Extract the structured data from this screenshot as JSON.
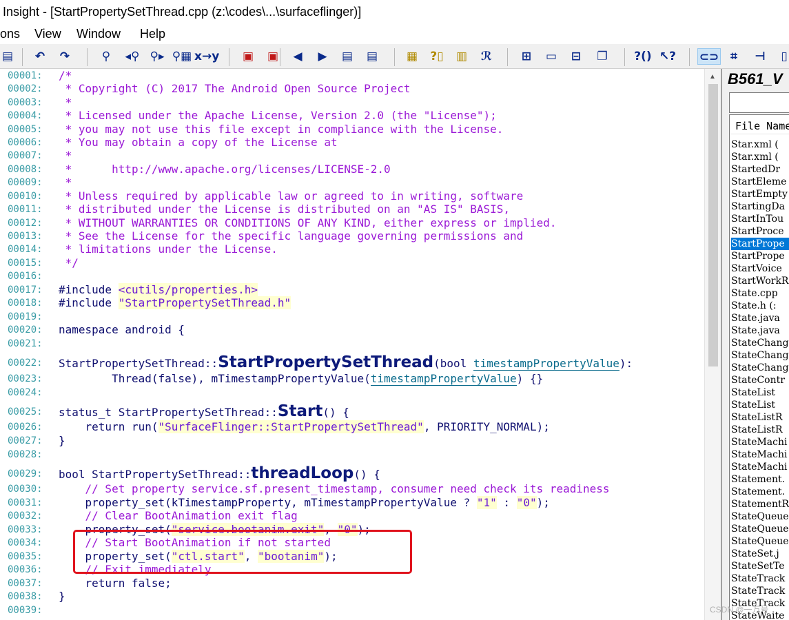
{
  "window": {
    "title": "Insight - [StartPropertySetThread.cpp (z:\\codes\\...\\surfaceflinger)]"
  },
  "menu": [
    "ons",
    "View",
    "Window",
    "Help"
  ],
  "toolbar_icons": [
    {
      "name": "paste-icon",
      "glyph": "▤"
    },
    {
      "name": "undo-icon",
      "glyph": "↶"
    },
    {
      "name": "redo-icon",
      "glyph": "↷"
    },
    {
      "name": "find-icon",
      "glyph": "⚲"
    },
    {
      "name": "find-prev-icon",
      "glyph": "◂⚲"
    },
    {
      "name": "find-next-icon",
      "glyph": "⚲▸"
    },
    {
      "name": "find-files-icon",
      "glyph": "⚲▦"
    },
    {
      "name": "replace-icon",
      "glyph": "x→y"
    },
    {
      "name": "bookmark-prev-icon",
      "glyph": "▣"
    },
    {
      "name": "bookmark-next-icon",
      "glyph": "▣"
    },
    {
      "name": "back-icon",
      "glyph": "◀"
    },
    {
      "name": "forward-icon",
      "glyph": "▶"
    },
    {
      "name": "jump-prev-icon",
      "glyph": "▤"
    },
    {
      "name": "jump-next-icon",
      "glyph": "▤"
    },
    {
      "name": "lookup-icon",
      "glyph": "▦"
    },
    {
      "name": "symbol-info-icon",
      "glyph": "?▯"
    },
    {
      "name": "browse-icon",
      "glyph": "▥"
    },
    {
      "name": "relation-icon",
      "glyph": "ℛ"
    },
    {
      "name": "layout-grid-icon",
      "glyph": "⊞"
    },
    {
      "name": "layout-panel-icon",
      "glyph": "▭"
    },
    {
      "name": "layout-split-icon",
      "glyph": "⊟"
    },
    {
      "name": "layout-windows-icon",
      "glyph": "❐"
    },
    {
      "name": "help-icon",
      "glyph": "?()"
    },
    {
      "name": "context-help-icon",
      "glyph": "↖?"
    },
    {
      "name": "link-icon",
      "glyph": "⊂⊃"
    },
    {
      "name": "context-window-icon",
      "glyph": "⌗"
    },
    {
      "name": "relation-window-icon",
      "glyph": "⊣"
    },
    {
      "name": "more-icon",
      "glyph": "▯"
    }
  ],
  "editor": {
    "lines": [
      {
        "n": "00001:",
        "parts": [
          {
            "t": "/*",
            "c": "cm"
          }
        ]
      },
      {
        "n": "00002:",
        "parts": [
          {
            "t": " * Copyright (C) 2017 The Android Open Source Project",
            "c": "cm"
          }
        ]
      },
      {
        "n": "00003:",
        "parts": [
          {
            "t": " *",
            "c": "cm"
          }
        ]
      },
      {
        "n": "00004:",
        "parts": [
          {
            "t": " * Licensed under the Apache License, Version 2.0 (the \"License\");",
            "c": "cm"
          }
        ]
      },
      {
        "n": "00005:",
        "parts": [
          {
            "t": " * you may not use this file except in compliance with the License.",
            "c": "cm"
          }
        ]
      },
      {
        "n": "00006:",
        "parts": [
          {
            "t": " * You may obtain a copy of the License at",
            "c": "cm"
          }
        ]
      },
      {
        "n": "00007:",
        "parts": [
          {
            "t": " *",
            "c": "cm"
          }
        ]
      },
      {
        "n": "00008:",
        "parts": [
          {
            "t": " *      http://www.apache.org/licenses/LICENSE-2.0",
            "c": "cm"
          }
        ]
      },
      {
        "n": "00009:",
        "parts": [
          {
            "t": " *",
            "c": "cm"
          }
        ]
      },
      {
        "n": "00010:",
        "parts": [
          {
            "t": " * Unless required by applicable law or agreed to in writing, software",
            "c": "cm"
          }
        ]
      },
      {
        "n": "00011:",
        "parts": [
          {
            "t": " * distributed under the License is distributed on an \"AS IS\" BASIS,",
            "c": "cm"
          }
        ]
      },
      {
        "n": "00012:",
        "parts": [
          {
            "t": " * WITHOUT WARRANTIES OR CONDITIONS OF ANY KIND, either express or implied.",
            "c": "cm"
          }
        ]
      },
      {
        "n": "00013:",
        "parts": [
          {
            "t": " * See the License for the specific language governing permissions and",
            "c": "cm"
          }
        ]
      },
      {
        "n": "00014:",
        "parts": [
          {
            "t": " * limitations under the License.",
            "c": "cm"
          }
        ]
      },
      {
        "n": "00015:",
        "parts": [
          {
            "t": " */",
            "c": "cm"
          }
        ]
      },
      {
        "n": "00016:",
        "parts": []
      },
      {
        "n": "00017:",
        "parts": [
          {
            "t": "#include ",
            "c": "kw"
          },
          {
            "t": "<cutils/properties.h>",
            "c": "str"
          }
        ]
      },
      {
        "n": "00018:",
        "parts": [
          {
            "t": "#include ",
            "c": "kw"
          },
          {
            "t": "\"StartPropertySetThread.h\"",
            "c": "str"
          }
        ]
      },
      {
        "n": "00019:",
        "parts": []
      },
      {
        "n": "00020:",
        "parts": [
          {
            "t": "namespace android {",
            "c": "kw"
          }
        ]
      },
      {
        "n": "00021:",
        "parts": []
      },
      {
        "n": "00022:",
        "big": true,
        "parts": [
          {
            "t": "StartPropertySetThread::",
            "c": "kw"
          },
          {
            "t": "StartPropertySetThread",
            "c": "fn"
          },
          {
            "t": "(bool ",
            "c": "kw"
          },
          {
            "t": "timestampPropertyValue",
            "c": "pl"
          },
          {
            "t": "):",
            "c": "kw"
          }
        ]
      },
      {
        "n": "00023:",
        "parts": [
          {
            "t": "        Thread(false), mTimestampPropertyValue(",
            "c": "kw"
          },
          {
            "t": "timestampPropertyValue",
            "c": "pl"
          },
          {
            "t": ") {}",
            "c": "kw"
          }
        ]
      },
      {
        "n": "00024:",
        "parts": []
      },
      {
        "n": "00025:",
        "big": true,
        "parts": [
          {
            "t": "status_t StartPropertySetThread::",
            "c": "kw"
          },
          {
            "t": "Start",
            "c": "fn"
          },
          {
            "t": "() {",
            "c": "kw"
          }
        ]
      },
      {
        "n": "00026:",
        "parts": [
          {
            "t": "    return run(",
            "c": "kw"
          },
          {
            "t": "\"SurfaceFlinger::StartPropertySetThread\"",
            "c": "str"
          },
          {
            "t": ", PRIORITY_NORMAL);",
            "c": "kw"
          }
        ]
      },
      {
        "n": "00027:",
        "parts": [
          {
            "t": "}",
            "c": "kw"
          }
        ]
      },
      {
        "n": "00028:",
        "parts": []
      },
      {
        "n": "00029:",
        "big": true,
        "parts": [
          {
            "t": "bool StartPropertySetThread::",
            "c": "kw"
          },
          {
            "t": "threadLoop",
            "c": "fn"
          },
          {
            "t": "() {",
            "c": "kw"
          }
        ]
      },
      {
        "n": "00030:",
        "parts": [
          {
            "t": "    // Set property service.sf.present_timestamp, consumer need check its readiness",
            "c": "cm"
          }
        ]
      },
      {
        "n": "00031:",
        "parts": [
          {
            "t": "    property_set(kTimestampProperty, mTimestampPropertyValue ? ",
            "c": "kw"
          },
          {
            "t": "\"1\"",
            "c": "str"
          },
          {
            "t": " : ",
            "c": "kw"
          },
          {
            "t": "\"0\"",
            "c": "str"
          },
          {
            "t": ");",
            "c": "kw"
          }
        ]
      },
      {
        "n": "00032:",
        "parts": [
          {
            "t": "    // Clear BootAnimation exit flag",
            "c": "cm"
          }
        ]
      },
      {
        "n": "00033:",
        "parts": [
          {
            "t": "    property_set(",
            "c": "kw"
          },
          {
            "t": "\"service.bootanim.exit\"",
            "c": "str"
          },
          {
            "t": ", ",
            "c": "kw"
          },
          {
            "t": "\"0\"",
            "c": "str"
          },
          {
            "t": ");",
            "c": "kw"
          }
        ]
      },
      {
        "n": "00034:",
        "parts": [
          {
            "t": "    // Start BootAnimation if not started",
            "c": "cm"
          }
        ]
      },
      {
        "n": "00035:",
        "parts": [
          {
            "t": "    property_set(",
            "c": "kw"
          },
          {
            "t": "\"ctl.start\"",
            "c": "str"
          },
          {
            "t": ", ",
            "c": "kw"
          },
          {
            "t": "\"bootanim\"",
            "c": "str"
          },
          {
            "t": ");",
            "c": "kw"
          }
        ]
      },
      {
        "n": "00036:",
        "parts": [
          {
            "t": "    // Exit immediately",
            "c": "cm"
          }
        ]
      },
      {
        "n": "00037:",
        "parts": [
          {
            "t": "    return false;",
            "c": "kw"
          }
        ]
      },
      {
        "n": "00038:",
        "parts": [
          {
            "t": "}",
            "c": "kw"
          }
        ]
      },
      {
        "n": "00039:",
        "parts": []
      }
    ]
  },
  "project_panel": {
    "title": "B561_V",
    "search_value": "",
    "column_header": "File Name",
    "files": [
      "Star.xml (",
      "Star.xml (",
      "StartedDr",
      "StartEleme",
      "StartEmpty",
      "StartingDa",
      "StartInTou",
      "StartProce",
      "StartPrope",
      "StartPrope",
      "StartVoice",
      "StartWorkR",
      "State.cpp",
      "State.h (:",
      "State.java",
      "State.java",
      "StateChang",
      "StateChang",
      "StateChang",
      "StateContr",
      "StateList",
      "StateList",
      "StateListR",
      "StateListR",
      "StateMachi",
      "StateMachi",
      "StateMachi",
      "Statement.",
      "Statement.",
      "StatementR",
      "StateQueue",
      "StateQueue",
      "StateQueue",
      "StateSet.j",
      "StateSetTe",
      "StateTrack",
      "StateTrack",
      "StateTrack",
      "StateWaite"
    ],
    "selected_index": 8
  },
  "watermark": "CSDN @一万号",
  "colors": {
    "comment": "#9b1ad6",
    "keyword": "#0f3c7d",
    "string_bg": "#ffffd0",
    "line_number": "#3a9ca6",
    "highlight_box": "#e0141e",
    "selection": "#0078d7"
  }
}
